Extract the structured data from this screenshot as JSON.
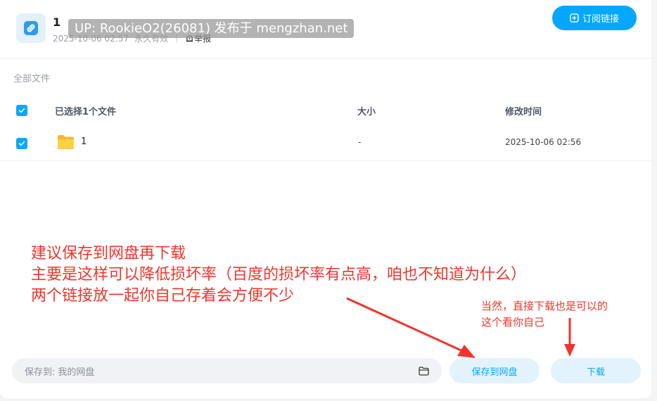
{
  "header": {
    "title": "1",
    "date": "2025-10-06 02:57",
    "validity": "永久有效",
    "report_label": "举报",
    "watermark": "UP: RookieO2(26081) 发布于 mengzhan.net",
    "subscribe_label": "订阅链接"
  },
  "breadcrumb": "全部文件",
  "table": {
    "columns": {
      "name": "已选择1个文件",
      "size": "大小",
      "modified": "修改时间"
    },
    "rows": [
      {
        "name": "1",
        "size": "-",
        "modified": "2025-10-06 02:56",
        "checked": true
      }
    ]
  },
  "annotations": {
    "main_lines": [
      "建议保存到网盘再下载",
      "主要是这样可以降低损坏率（百度的损坏率有点高，咱也不知道为什么）",
      "两个链接放一起你自己存着会方便不少"
    ],
    "side_lines": [
      "当然，直接下载也是可以的",
      "这个看你自己"
    ]
  },
  "footer": {
    "save_path_label": "保存到:",
    "save_path_value": "我的网盘",
    "save_button": "保存到网盘",
    "download_button": "下载"
  },
  "colors": {
    "accent": "#06a7ff",
    "annotation": "#f0352c"
  }
}
